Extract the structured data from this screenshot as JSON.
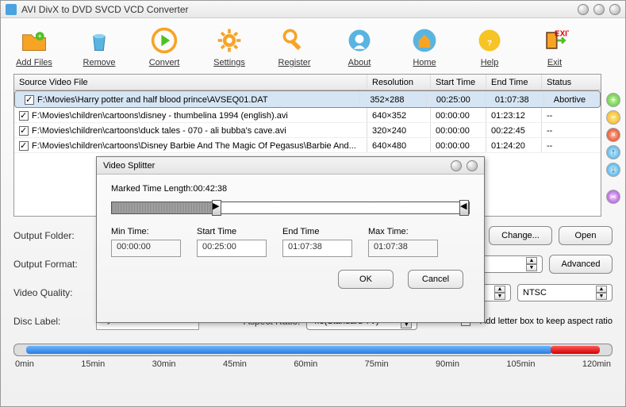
{
  "window": {
    "title": "AVI DivX to DVD SVCD VCD Converter"
  },
  "toolbar": [
    {
      "label": "Add Files",
      "name": "add-files"
    },
    {
      "label": "Remove",
      "name": "remove"
    },
    {
      "label": "Convert",
      "name": "convert"
    },
    {
      "label": "Settings",
      "name": "settings"
    },
    {
      "label": "Register",
      "name": "register"
    },
    {
      "label": "About",
      "name": "about"
    },
    {
      "label": "Home",
      "name": "home"
    },
    {
      "label": "Help",
      "name": "help"
    },
    {
      "label": "Exit",
      "name": "exit"
    }
  ],
  "table": {
    "headers": {
      "source": "Source Video File",
      "resolution": "Resolution",
      "start": "Start Time",
      "end": "End Time",
      "status": "Status"
    },
    "rows": [
      {
        "file": "F:\\Movies\\Harry potter and half blood prince\\AVSEQ01.DAT",
        "res": "352×288",
        "start": "00:25:00",
        "end": "01:07:38",
        "status": "Abortive",
        "selected": true
      },
      {
        "file": "F:\\Movies\\children\\cartoons\\disney - thumbelina 1994 (english).avi",
        "res": "640×352",
        "start": "00:00:00",
        "end": "01:23:12",
        "status": "--",
        "selected": false
      },
      {
        "file": "F:\\Movies\\children\\cartoons\\duck tales - 070 - ali bubba's cave.avi",
        "res": "320×240",
        "start": "00:00:00",
        "end": "00:22:45",
        "status": "--",
        "selected": false
      },
      {
        "file": "F:\\Movies\\children\\cartoons\\Disney Barbie And The Magic Of Pegasus\\Barbie And...",
        "res": "640×480",
        "start": "00:00:00",
        "end": "01:24:20",
        "status": "--",
        "selected": false
      }
    ]
  },
  "form": {
    "outputFolderLabel": "Output Folder:",
    "outputFormatLabel": "Output Format:",
    "videoQualityLabel": "Video Quality:",
    "discLabelLabel": "Disc Label:",
    "aspectRatioLabel": "Aspect Ratio:",
    "change": "Change...",
    "open": "Open",
    "advanced": "Advanced",
    "ntsc": "NTSC",
    "discLabel": "MyDisc",
    "aspectRatio": "4:3(Standard TV)",
    "letterbox": "Add letter box to keep aspect ratio"
  },
  "timeline": {
    "ticks": [
      "0min",
      "15min",
      "30min",
      "45min",
      "60min",
      "75min",
      "90min",
      "105min",
      "120min"
    ]
  },
  "dialog": {
    "title": "Video Splitter",
    "markedTime": "Marked Time Length:00:42:38",
    "minTimeLabel": "Min Time:",
    "startTimeLabel": "Start Time",
    "endTimeLabel": "End Time",
    "maxTimeLabel": "Max Time:",
    "minTime": "00:00:00",
    "startTime": "00:25:00",
    "endTime": "01:07:38",
    "maxTime": "01:07:38",
    "ok": "OK",
    "cancel": "Cancel"
  }
}
